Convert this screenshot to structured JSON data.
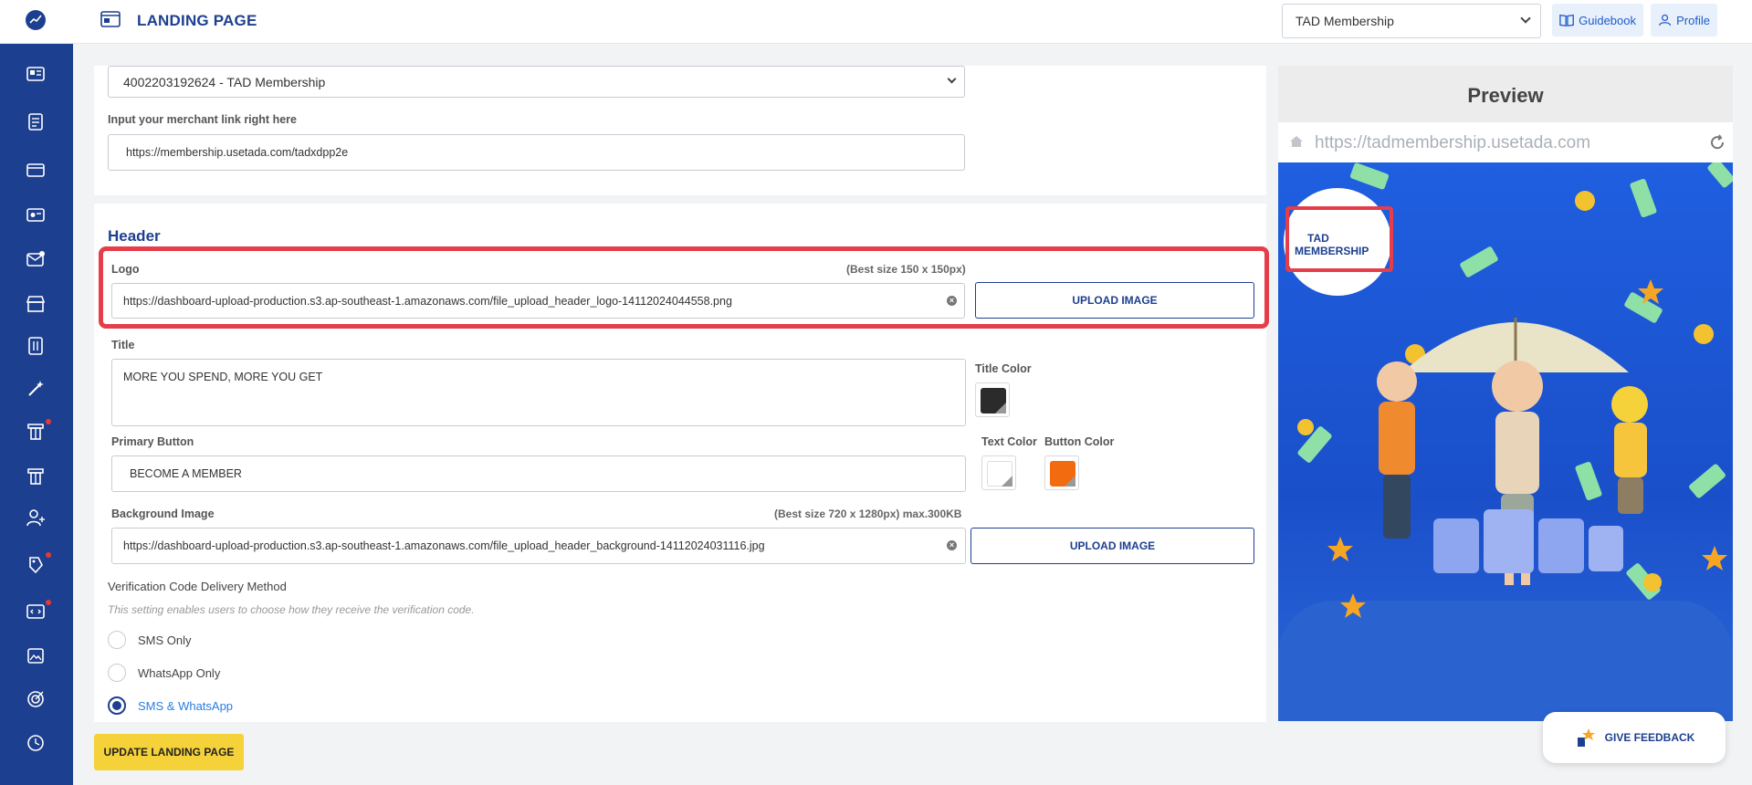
{
  "topbar": {
    "page_title": "LANDING PAGE",
    "membership_select": "TAD Membership",
    "guidebook_label": "Guidebook",
    "profile_label": "Profile"
  },
  "merchant": {
    "account_select": "4002203192624 - TAD Membership",
    "link_label": "Input your merchant link right here",
    "link_value": "https://membership.usetada.com/tadxdpp2e"
  },
  "header": {
    "section_title": "Header",
    "logo_label": "Logo",
    "logo_hint": "(Best size 150 x 150px)",
    "logo_value": "https://dashboard-upload-production.s3.ap-southeast-1.amazonaws.com/file_upload_header_logo-14112024044558.png",
    "upload_label": "UPLOAD IMAGE",
    "title_label": "Title",
    "title_value": "MORE YOU SPEND, MORE YOU GET",
    "title_color_label": "Title Color",
    "title_color": "#2b2b2b",
    "primary_button_label": "Primary Button",
    "primary_button_value": "BECOME A MEMBER",
    "text_color_label": "Text Color",
    "text_color": "#ffffff",
    "button_color_label": "Button Color",
    "button_color": "#f26b0f",
    "bg_label": "Background Image",
    "bg_hint": "(Best size 720 x 1280px) max.300KB",
    "bg_value": "https://dashboard-upload-production.s3.ap-southeast-1.amazonaws.com/file_upload_header_background-14112024031116.jpg",
    "bg_upload_label": "UPLOAD IMAGE"
  },
  "verification": {
    "label": "Verification Code Delivery Method",
    "description": "This setting enables users to choose how they receive the verification code.",
    "options": [
      "SMS Only",
      "WhatsApp Only",
      "SMS & WhatsApp"
    ],
    "selected": "SMS & WhatsApp"
  },
  "actions": {
    "update_label": "UPDATE LANDING PAGE",
    "feedback_label": "GIVE FEEDBACK"
  },
  "preview": {
    "title": "Preview",
    "url": "https://tadmembership.usetada.com",
    "logo_line1": "TAD",
    "logo_line2": "MEMBERSHIP"
  },
  "colors": {
    "brand": "#1d3f8f",
    "highlight": "#e53d4a",
    "accent": "#f6d23a"
  }
}
